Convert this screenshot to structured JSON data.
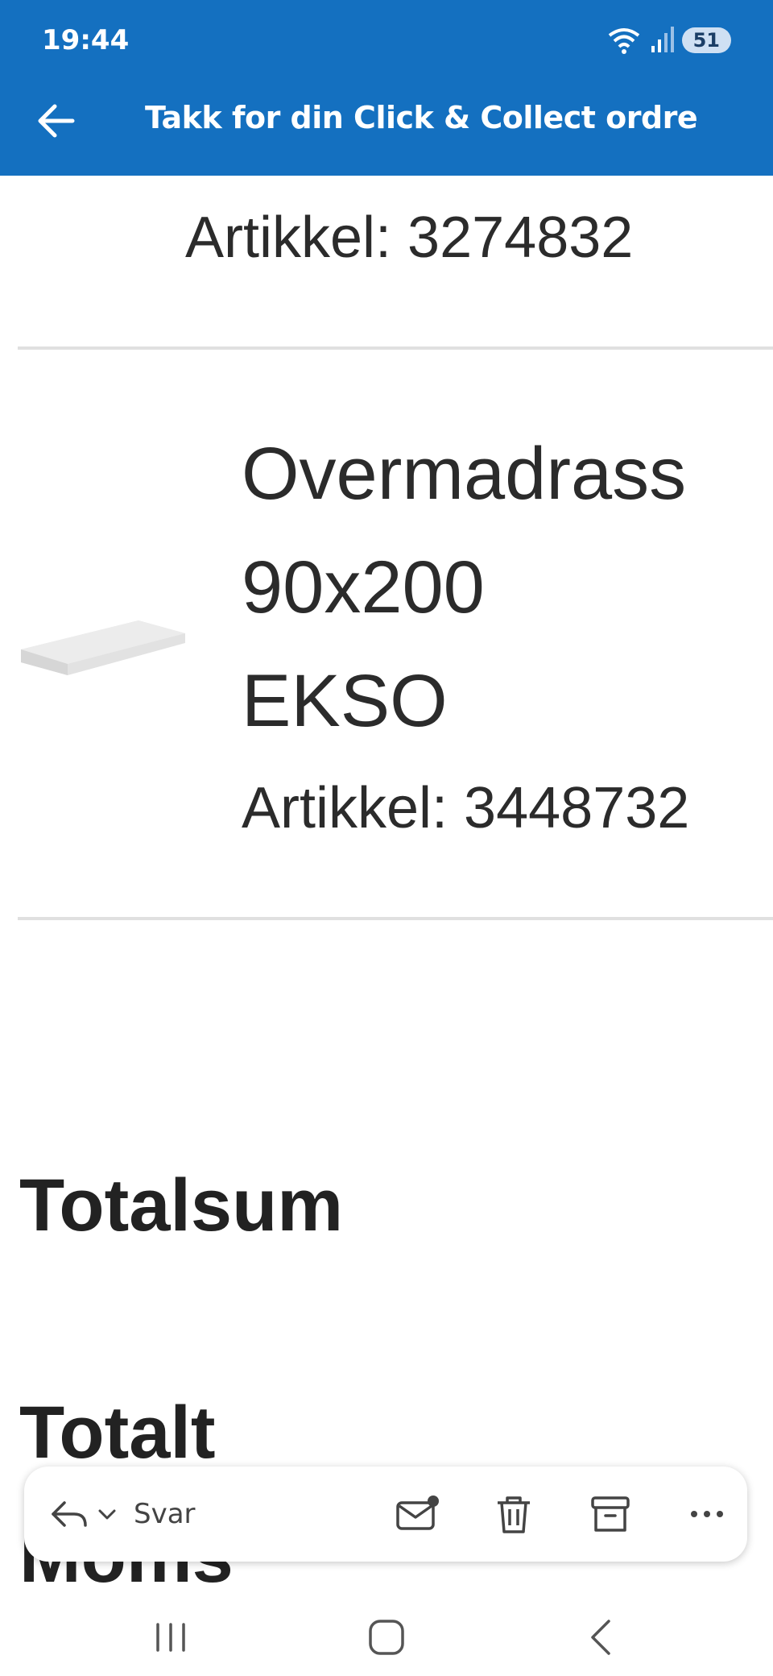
{
  "status_bar": {
    "time": "19:44",
    "battery": "51"
  },
  "header": {
    "title": "Takk for din Click & Collect ordre"
  },
  "items": [
    {
      "article": "Artikkel: 3274832"
    },
    {
      "name_lines": [
        "Overmadrass",
        "90x200",
        "EKSO"
      ],
      "article": "Artikkel: 3448732",
      "image": "mattress-topper-image"
    }
  ],
  "summary": {
    "total_sum_label": "Totalsum",
    "total_label": "Totalt",
    "vat_label": "Moms"
  },
  "action_bar": {
    "reply_label": "Svar",
    "icons": [
      "reply-icon",
      "chevron-down-icon",
      "mark-unread-icon",
      "delete-icon",
      "archive-icon",
      "more-icon"
    ]
  },
  "nav_bar": {
    "icons": [
      "recent-apps-icon",
      "home-icon",
      "back-icon"
    ]
  },
  "colors": {
    "header_bg": "#1470c0",
    "header_text": "#ffffff",
    "text": "#2b2b2b"
  }
}
